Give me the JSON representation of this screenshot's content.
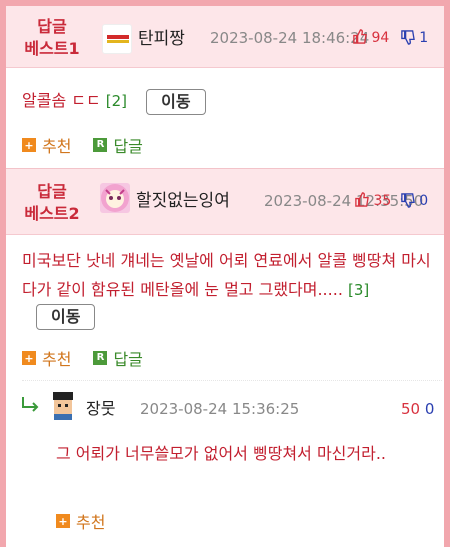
{
  "comments": [
    {
      "best_label_line1": "답글",
      "best_label_line2": "베스트1",
      "nickname": "탄피짱",
      "date": "2023-08-24 18:46:24",
      "upvotes": "94",
      "downvotes": "1",
      "text": "알콜솜 ㄷㄷ",
      "reply_count": "[2]",
      "move_label": "이동",
      "recommend_label": "추천",
      "reply_label": "답글"
    },
    {
      "best_label_line1": "답글",
      "best_label_line2": "베스트2",
      "nickname": "할짓없는잉여",
      "date": "2023-08-24 12:35:50",
      "upvotes": "35",
      "downvotes": "0",
      "text": "미국보단 낫네 걔네는 옛날에 어뢰 연료에서 알콜 삥땅쳐 마시다가 같이 함유된 메탄올에 눈 멀고 그랬다며.....",
      "reply_count": "[3]",
      "move_label": "이동",
      "recommend_label": "추천",
      "reply_label": "답글"
    }
  ],
  "reply": {
    "nickname": "장뭇",
    "date": "2023-08-24 15:36:25",
    "upvotes": "50",
    "downvotes": "0",
    "text": "그 어뢰가 너무쓸모가 없어서 삥땅쳐서 마신거라..",
    "recommend_label": "추천"
  },
  "colors": {
    "best_header_bg": "#fde6e9",
    "frame_border": "#f2a7ae",
    "comment_text": "#c21f2f",
    "upvote": "#d8323f",
    "downvote": "#2a3fb0"
  },
  "icons": [
    "thumbs-up-icon",
    "thumbs-down-icon",
    "plus-icon",
    "reply-r-icon",
    "reply-arrow-icon",
    "avatar"
  ]
}
